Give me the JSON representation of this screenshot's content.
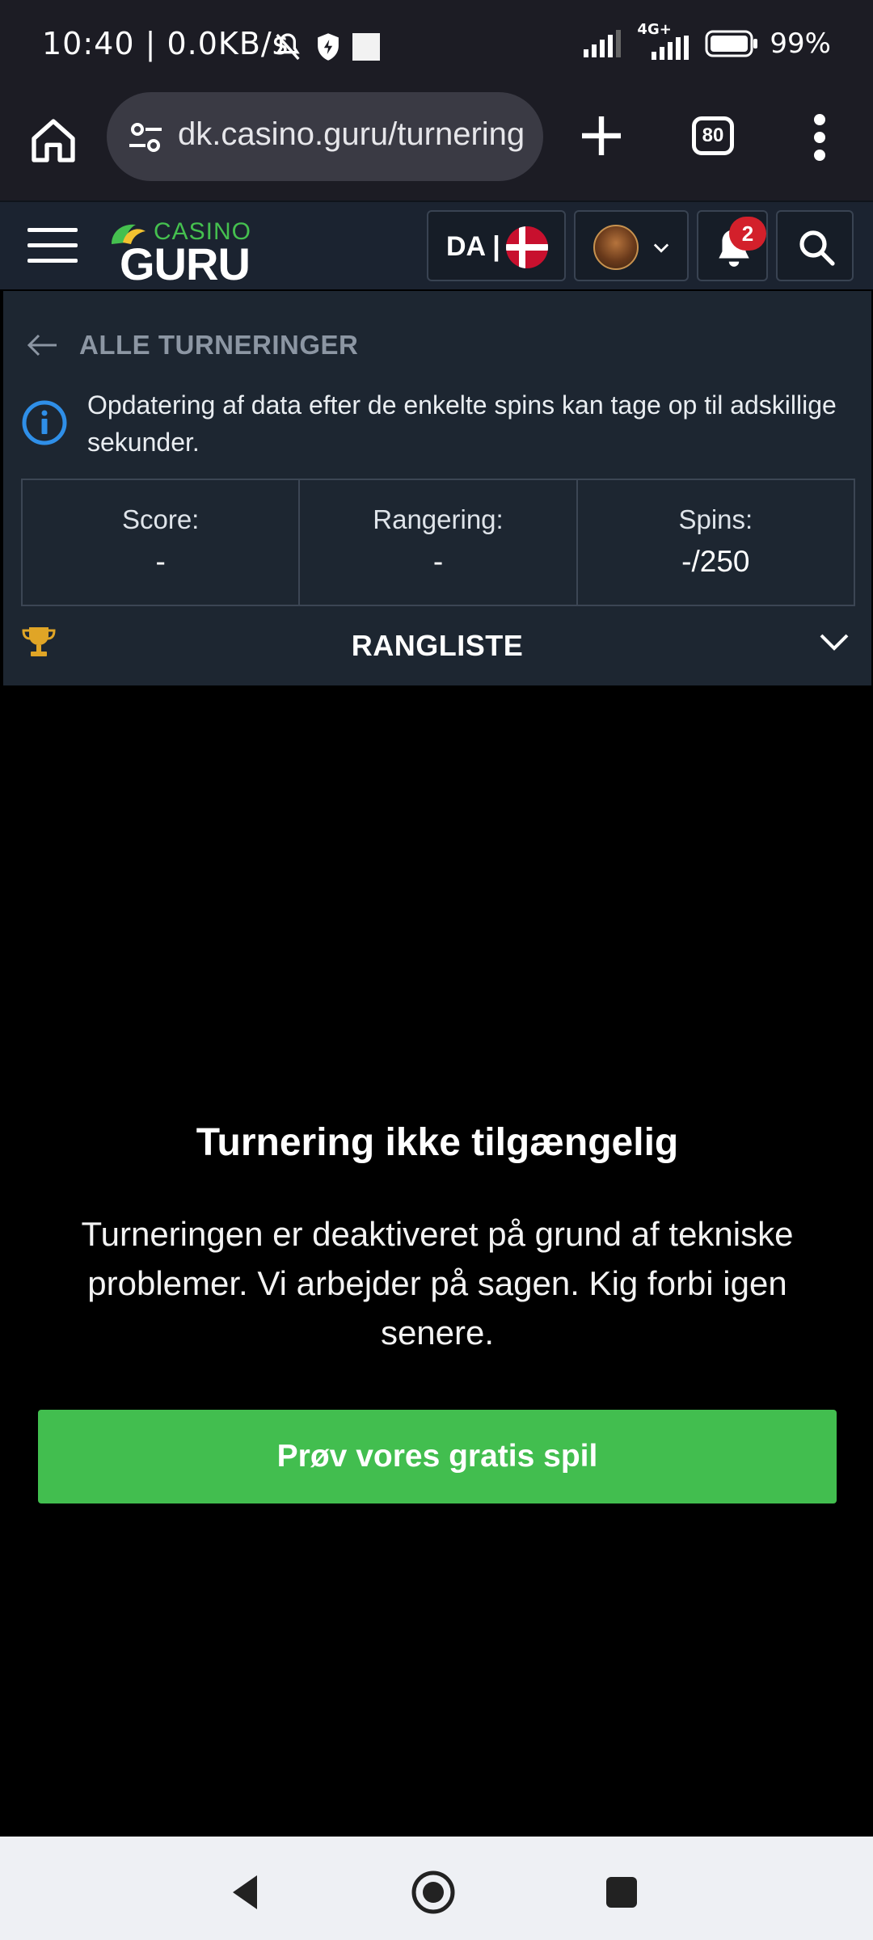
{
  "status_bar": {
    "time_and_speed": "10:40 | 0.0KB/s",
    "network": "4G+",
    "battery": "99%"
  },
  "browser": {
    "url": "dk.casino.guru/turnering",
    "tab_count": "80"
  },
  "site_header": {
    "logo_casino": "CASINO",
    "logo_guru": "GURU",
    "language": "DA |",
    "notification_count": "2"
  },
  "panel": {
    "back_label": "ALLE TURNERINGER",
    "info_message": "Opdatering af data efter de enkelte spins kan tage op til adskillige sekunder.",
    "stats": [
      {
        "label": "Score:",
        "value": "-"
      },
      {
        "label": "Rangering:",
        "value": "-"
      },
      {
        "label": "Spins:",
        "value": "-/250"
      }
    ],
    "leaderboard_title": "RANGLISTE"
  },
  "content": {
    "heading": "Turnering ikke tilgængelig",
    "description": "Turneringen er deaktiveret på grund af tekniske problemer. Vi arbejder på sagen. Kig forbi igen senere.",
    "cta_label": "Prøv vores gratis spil"
  },
  "colors": {
    "accent_green": "#42be4f",
    "header_bg": "#1b2330",
    "panel_bg": "#1d2631",
    "badge_red": "#d3202b",
    "info_blue": "#2f8fe8"
  }
}
